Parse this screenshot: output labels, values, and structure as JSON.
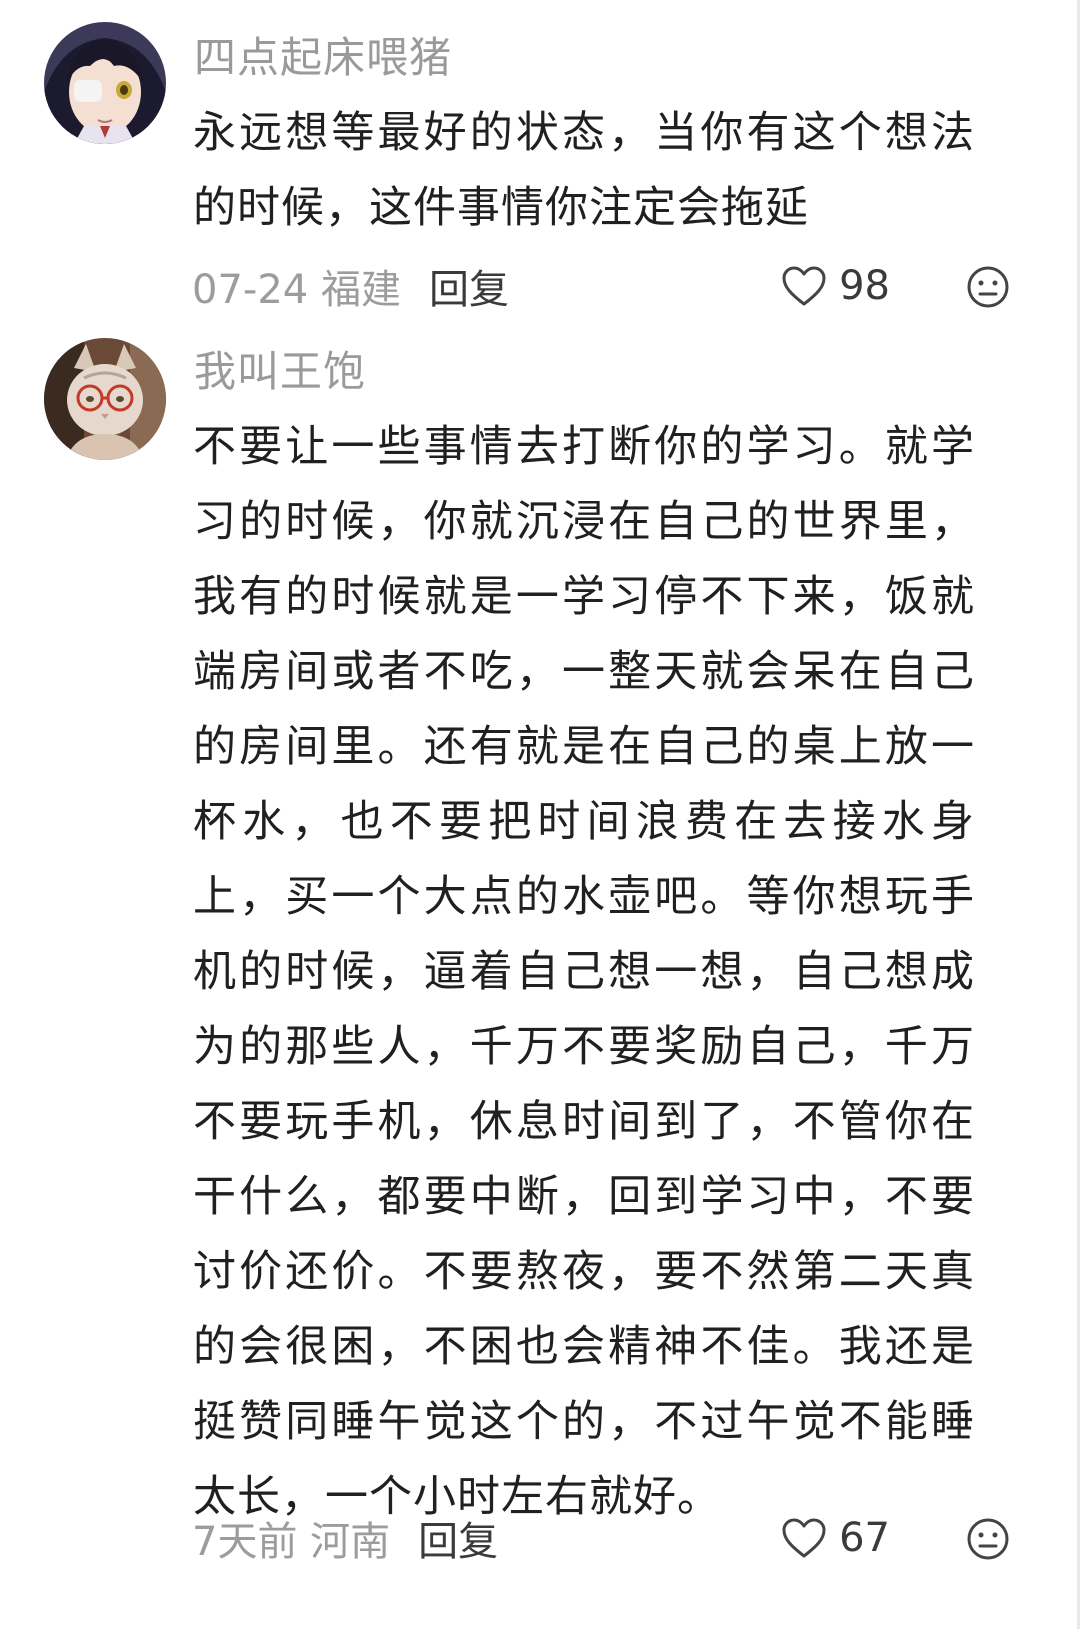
{
  "comments": [
    {
      "username": "四点起床喂猪",
      "text": "永远想等最好的状态，当你有这个想法的时候，这件事情你注定会拖延",
      "date_location": "07-24 福建",
      "reply_label": "回复",
      "likes": "98",
      "avatar_icon": "anime-girl-eyepatch-avatar",
      "like_icon": "heart-outline-icon",
      "reaction_icon": "neutral-face-icon"
    },
    {
      "username": "我叫王饱",
      "text": "不要让一些事情去打断你的学习。就学习的时候，你就沉浸在自己的世界里，我有的时候就是一学习停不下来，饭就端房间或者不吃，一整天就会呆在自己的房间里。还有就是在自己的桌上放一杯水，也不要把时间浪费在去接水身上，买一个大点的水壶吧。等你想玩手机的时候，逼着自己想一想，自己想成为的那些人，千万不要奖励自己，千万不要玩手机，休息时间到了，不管你在干什么，都要中断，回到学习中，不要讨价还价。不要熬夜，要不然第二天真的会很困，不困也会精神不佳。我还是挺赞同睡午觉这个的，不过午觉不能睡太长，一个小时左右就好。",
      "date_location": "7天前 河南",
      "reply_label": "回复",
      "likes": "67",
      "avatar_icon": "cat-with-glasses-avatar",
      "like_icon": "heart-outline-icon",
      "reaction_icon": "neutral-face-icon"
    }
  ],
  "colors": {
    "username": "#9a9a9a",
    "text": "#202020",
    "meta": "#9c9c9c",
    "action": "#3a3a3a"
  }
}
